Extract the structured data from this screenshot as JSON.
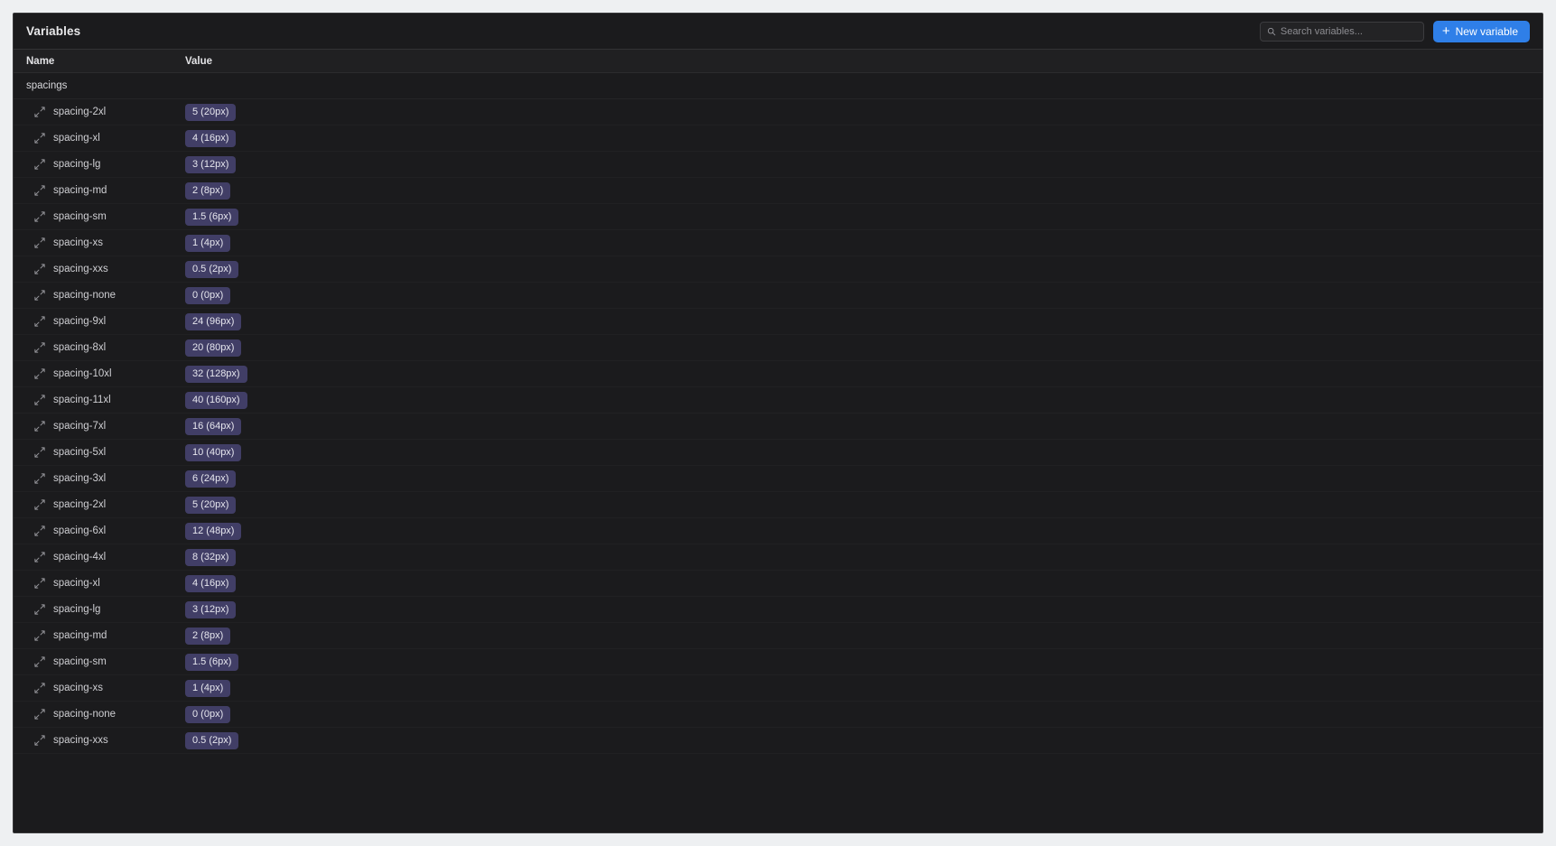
{
  "panel": {
    "title": "Variables",
    "search": {
      "placeholder": "Search variables...",
      "value": "",
      "icon": "search-icon"
    },
    "new_button": {
      "label": "New variable",
      "icon": "plus-icon",
      "color": "#2f7fe8"
    }
  },
  "table": {
    "columns": [
      "Name",
      "Value"
    ],
    "groups": [
      {
        "name": "spacings",
        "row_icon": "resize-diagonal-icon",
        "badge_color": "#413e66",
        "rows": [
          {
            "name": "spacing-2xl",
            "value": "5 (20px)"
          },
          {
            "name": "spacing-xl",
            "value": "4 (16px)"
          },
          {
            "name": "spacing-lg",
            "value": "3 (12px)"
          },
          {
            "name": "spacing-md",
            "value": "2 (8px)"
          },
          {
            "name": "spacing-sm",
            "value": "1.5 (6px)"
          },
          {
            "name": "spacing-xs",
            "value": "1 (4px)"
          },
          {
            "name": "spacing-xxs",
            "value": "0.5 (2px)"
          },
          {
            "name": "spacing-none",
            "value": "0 (0px)"
          },
          {
            "name": "spacing-9xl",
            "value": "24 (96px)"
          },
          {
            "name": "spacing-8xl",
            "value": "20 (80px)"
          },
          {
            "name": "spacing-10xl",
            "value": "32 (128px)"
          },
          {
            "name": "spacing-11xl",
            "value": "40 (160px)"
          },
          {
            "name": "spacing-7xl",
            "value": "16 (64px)"
          },
          {
            "name": "spacing-5xl",
            "value": "10 (40px)"
          },
          {
            "name": "spacing-3xl",
            "value": "6 (24px)"
          },
          {
            "name": "spacing-2xl",
            "value": "5 (20px)"
          },
          {
            "name": "spacing-6xl",
            "value": "12 (48px)"
          },
          {
            "name": "spacing-4xl",
            "value": "8 (32px)"
          },
          {
            "name": "spacing-xl",
            "value": "4 (16px)"
          },
          {
            "name": "spacing-lg",
            "value": "3 (12px)"
          },
          {
            "name": "spacing-md",
            "value": "2 (8px)"
          },
          {
            "name": "spacing-sm",
            "value": "1.5 (6px)"
          },
          {
            "name": "spacing-xs",
            "value": "1 (4px)"
          },
          {
            "name": "spacing-none",
            "value": "0 (0px)"
          },
          {
            "name": "spacing-xxs",
            "value": "0.5 (2px)"
          }
        ]
      }
    ]
  }
}
